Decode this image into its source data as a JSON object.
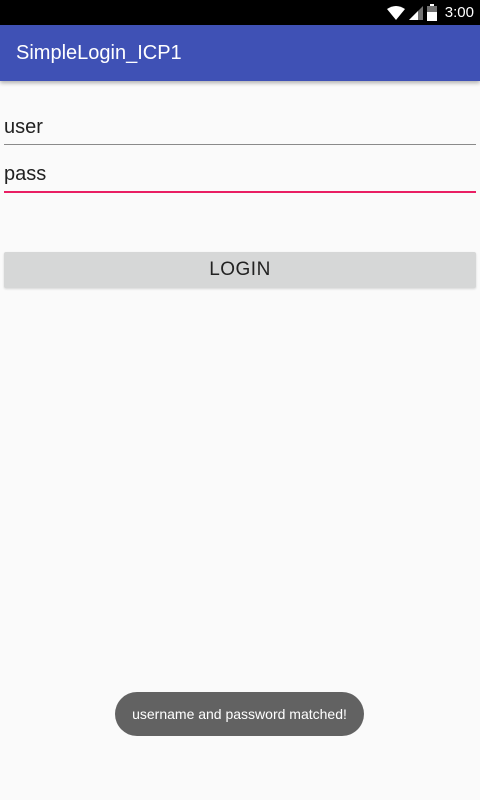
{
  "status_bar": {
    "time": "3:00",
    "icons": [
      "wifi-icon",
      "signal-icon",
      "battery-icon"
    ]
  },
  "app_bar": {
    "title": "SimpleLogin_ICP1",
    "color": "#3f51b5"
  },
  "form": {
    "username_value": "user",
    "password_value": "pass",
    "focused_field": "password",
    "accent_color": "#e91e63",
    "login_label": "LOGIN"
  },
  "toast": {
    "message": "username and password matched!"
  }
}
